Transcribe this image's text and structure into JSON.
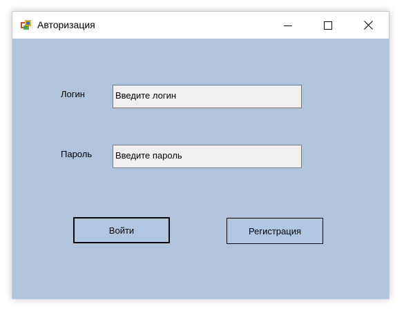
{
  "window": {
    "title": "Авторизация",
    "controls": {
      "minimize_icon": "minimize-icon",
      "maximize_icon": "maximize-icon",
      "close_icon": "close-icon"
    }
  },
  "form": {
    "login": {
      "label": "Логин",
      "value": "Введите логин"
    },
    "password": {
      "label": "Пароль",
      "value": "Введите пароль"
    },
    "buttons": {
      "login": "Войти",
      "register": "Регистрация"
    }
  },
  "colors": {
    "form_background": "#b0c4de",
    "button_background": "#b0c7e4",
    "textbox_background": "#f0f0f0"
  }
}
